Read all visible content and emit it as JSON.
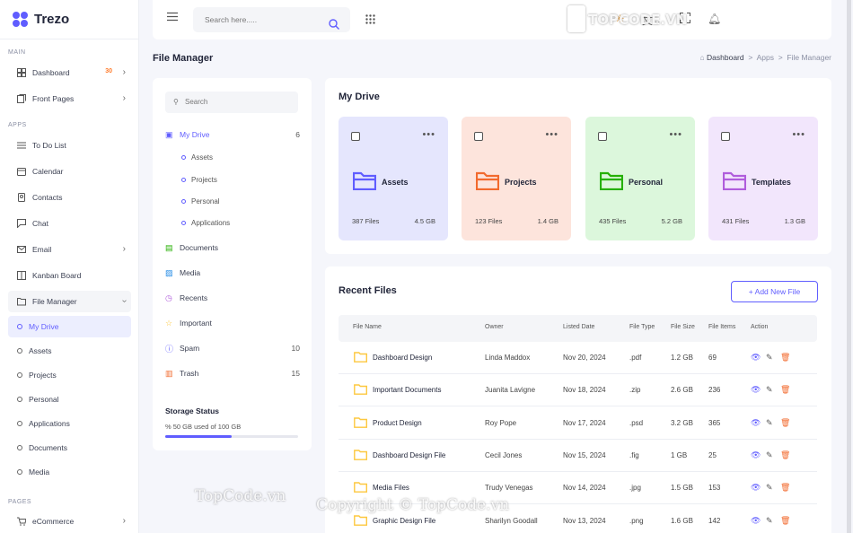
{
  "app": {
    "name": "Trezo"
  },
  "sidebar": {
    "sections": [
      "MAIN",
      "APPS",
      "PAGES"
    ],
    "items": [
      {
        "label": "Dashboard",
        "badge": "30"
      },
      {
        "label": "Front Pages"
      },
      {
        "label": "To Do List"
      },
      {
        "label": "Calendar"
      },
      {
        "label": "Contacts"
      },
      {
        "label": "Chat"
      },
      {
        "label": "Email"
      },
      {
        "label": "Kanban Board"
      },
      {
        "label": "File Manager"
      },
      {
        "label": "My Drive"
      },
      {
        "label": "Assets"
      },
      {
        "label": "Projects"
      },
      {
        "label": "Personal"
      },
      {
        "label": "Applications"
      },
      {
        "label": "Documents"
      },
      {
        "label": "Media"
      },
      {
        "label": "eCommerce"
      }
    ]
  },
  "topbar": {
    "search_placeholder": "Search here....."
  },
  "watermarks": {
    "logo": "TOPCODE.VN",
    "left": "TopCode.vn",
    "center": "Copyright © TopCode.vn"
  },
  "page": {
    "title": "File Manager",
    "breadcrumb": [
      "Dashboard",
      "Apps",
      "File Manager"
    ]
  },
  "fm_nav": {
    "search": "Search",
    "items": [
      {
        "label": "My Drive",
        "count": "6"
      },
      {
        "label": "Assets"
      },
      {
        "label": "Projects"
      },
      {
        "label": "Personal"
      },
      {
        "label": "Applications"
      },
      {
        "label": "Documents"
      },
      {
        "label": "Media"
      },
      {
        "label": "Recents"
      },
      {
        "label": "Important"
      },
      {
        "label": "Spam",
        "count": "10"
      },
      {
        "label": "Trash",
        "count": "15"
      }
    ],
    "storage_title": "Storage Status",
    "storage_text": "% 50 GB used of 100 GB",
    "storage_used_fraction": 0.5
  },
  "drive": {
    "title": "My Drive",
    "folders": [
      {
        "name": "Assets",
        "files": "387 Files",
        "size": "4.5 GB",
        "bg": "#e5e6fd",
        "color": "#605dff"
      },
      {
        "name": "Projects",
        "files": "123 Files",
        "size": "1.4 GB",
        "bg": "#fde4dc",
        "color": "#f26a2e"
      },
      {
        "name": "Personal",
        "files": "435 Files",
        "size": "5.2 GB",
        "bg": "#dcf7dc",
        "color": "#25b003"
      },
      {
        "name": "Templates",
        "files": "431 Files",
        "size": "1.3 GB",
        "bg": "#f2e6fc",
        "color": "#b05ddc"
      }
    ]
  },
  "recent": {
    "title": "Recent Files",
    "add_label": "+ Add New File",
    "columns": [
      "File Name",
      "Owner",
      "Listed Date",
      "File Type",
      "File Size",
      "File Items",
      "Action"
    ],
    "rows": [
      [
        "Dashboard Design",
        "Linda Maddox",
        "Nov 20, 2024",
        ".pdf",
        "1.2 GB",
        "69"
      ],
      [
        "Important Documents",
        "Juanita Lavigne",
        "Nov 18, 2024",
        ".zip",
        "2.6 GB",
        "236"
      ],
      [
        "Product Design",
        "Roy Pope",
        "Nov 17, 2024",
        ".psd",
        "3.2 GB",
        "365"
      ],
      [
        "Dashboard Design File",
        "Cecil Jones",
        "Nov 15, 2024",
        ".fig",
        "1 GB",
        "25"
      ],
      [
        "Media Files",
        "Trudy Venegas",
        "Nov 14, 2024",
        ".jpg",
        "1.5 GB",
        "153"
      ],
      [
        "Graphic Design File",
        "Sharilyn Goodall",
        "Nov 13, 2024",
        ".png",
        "1.6 GB",
        "142"
      ]
    ]
  },
  "colors": {
    "accent": "#605dff",
    "folder": "#fdc83f",
    "view": "#605dff",
    "edit": "#555555",
    "delete": "#f26a2e"
  },
  "icons": [
    "menu-icon",
    "search-icon",
    "apps-grid-icon",
    "sun-icon",
    "translate-icon",
    "fullscreen-icon",
    "bell-icon",
    "folder-icon",
    "eye-icon",
    "pencil-icon",
    "trash-icon"
  ]
}
